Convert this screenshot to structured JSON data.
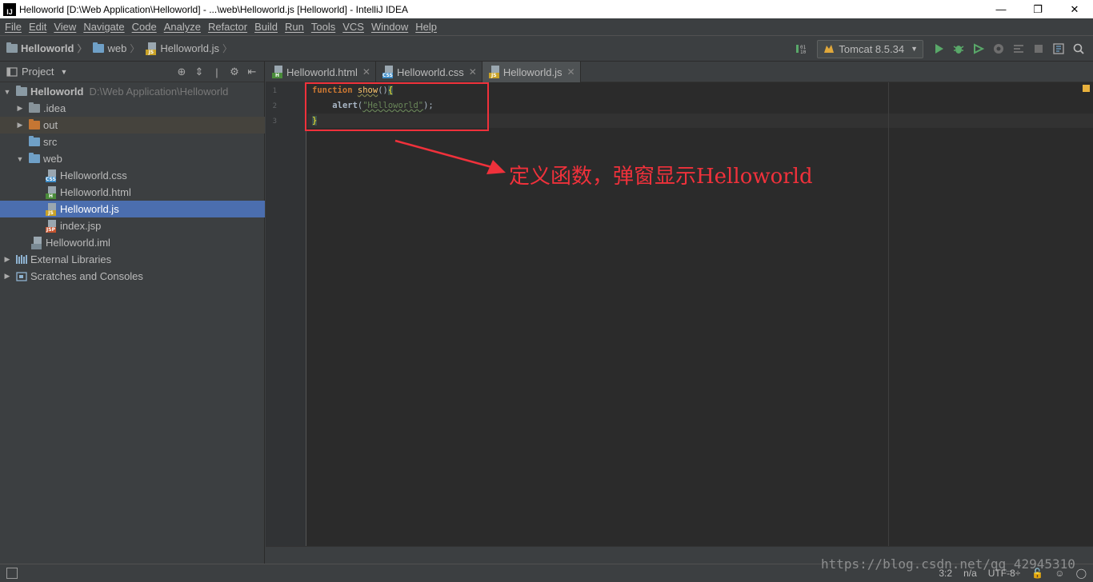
{
  "window": {
    "title": "Helloworld [D:\\Web Application\\Helloworld] - ...\\web\\Helloworld.js [Helloworld] - IntelliJ IDEA",
    "logo": "IJ",
    "minimize": "—",
    "restore": "❐",
    "close": "✕"
  },
  "menu": [
    "File",
    "Edit",
    "View",
    "Navigate",
    "Code",
    "Analyze",
    "Refactor",
    "Build",
    "Run",
    "Tools",
    "VCS",
    "Window",
    "Help"
  ],
  "breadcrumb": {
    "project": "Helloworld",
    "folder": "web",
    "file": "Helloworld.js"
  },
  "toolbar": {
    "run_config": "Tomcat 8.5.34",
    "icons": [
      "build-icon",
      "run-icon",
      "debug-icon",
      "coverage-icon",
      "profile-icon",
      "ant-icon",
      "stop-icon",
      "project-structure-icon",
      "search-icon"
    ]
  },
  "project_panel": {
    "title": "Project",
    "tree": [
      {
        "label": "Helloworld",
        "hint": "D:\\Web Application\\Helloworld",
        "depth": 0,
        "expanded": true,
        "type": "module"
      },
      {
        "label": ".idea",
        "depth": 1,
        "expanded": false,
        "type": "folder"
      },
      {
        "label": "out",
        "depth": 1,
        "expanded": false,
        "type": "folder-orange"
      },
      {
        "label": "src",
        "depth": 1,
        "type": "folder-blue"
      },
      {
        "label": "web",
        "depth": 1,
        "expanded": true,
        "type": "folder-blue"
      },
      {
        "label": "Helloworld.css",
        "depth": 2,
        "type": "css"
      },
      {
        "label": "Helloworld.html",
        "depth": 2,
        "type": "html"
      },
      {
        "label": "Helloworld.js",
        "depth": 2,
        "type": "js",
        "selected": true
      },
      {
        "label": "index.jsp",
        "depth": 2,
        "type": "jsp"
      },
      {
        "label": "Helloworld.iml",
        "depth": 1,
        "type": "iml"
      },
      {
        "label": "External Libraries",
        "depth": 0,
        "expanded": false,
        "type": "libraries"
      },
      {
        "label": "Scratches and Consoles",
        "depth": 0,
        "expanded": false,
        "type": "scratches"
      }
    ]
  },
  "tabs": [
    {
      "label": "Helloworld.html",
      "type": "html",
      "active": false
    },
    {
      "label": "Helloworld.css",
      "type": "css",
      "active": false
    },
    {
      "label": "Helloworld.js",
      "type": "js",
      "active": true
    }
  ],
  "editor": {
    "line_numbers": [
      "1",
      "2",
      "3"
    ],
    "code": {
      "l1_kw": "function",
      "l1_fn": "show",
      "l1_paren": "()",
      "l1_brace": "{",
      "l2_indent": "    ",
      "l2_call": "alert",
      "l2_open": "(",
      "l2_str": "\"Helloworld\"",
      "l2_close": ");",
      "l3_brace": "}"
    }
  },
  "annotation": {
    "text": "定义函数，弹窗显示Helloworld",
    "color": "#f0313b"
  },
  "status": {
    "position": "3:2",
    "line_sep": "n/a",
    "encoding": "UTF-8÷"
  },
  "watermark": "https://blog.csdn.net/qq_42945310",
  "colors": {
    "selection": "#4b6eaf",
    "editor_bg": "#2b2b2b",
    "panel_bg": "#3c3f41",
    "keyword": "#cc7832",
    "function": "#ffc66d",
    "string": "#6a8759"
  }
}
